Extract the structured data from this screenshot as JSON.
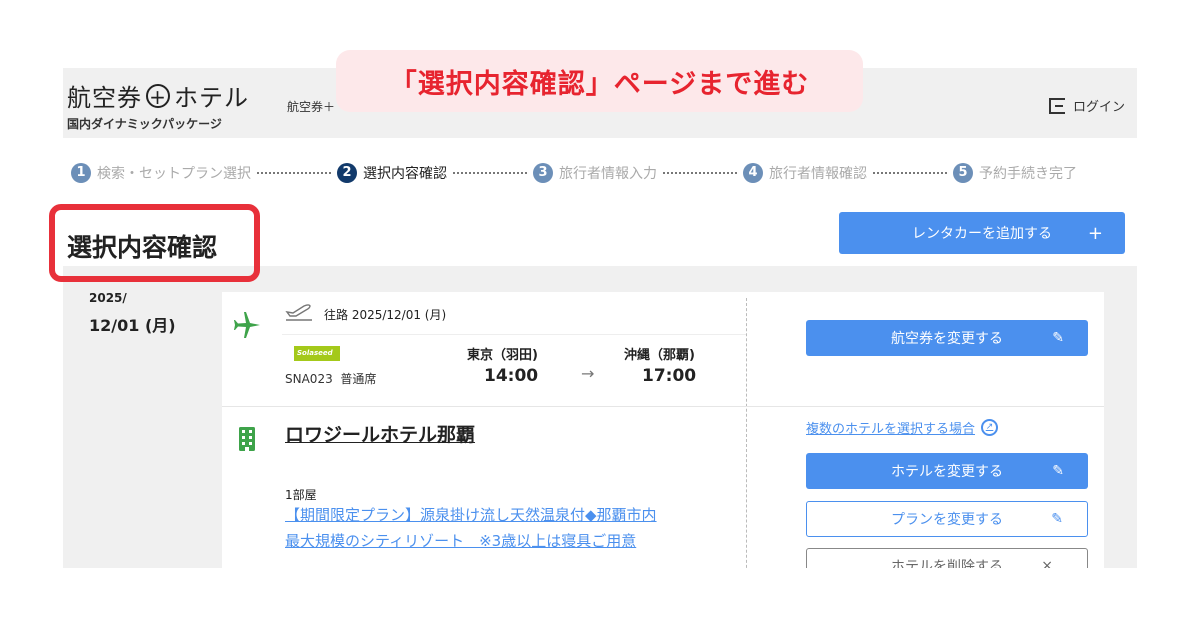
{
  "brand": {
    "title_left": "航空券",
    "plus": "+",
    "title_right": "ホテル",
    "subtitle": "国内ダイナミックパッケージ"
  },
  "nav": {
    "link": "航空券＋"
  },
  "login": {
    "label": "ログイン",
    "icon": "login-icon"
  },
  "banner": {
    "text": "「選択内容確認」ページまで進む"
  },
  "steps": [
    {
      "num": "1",
      "label": "検索・セットプラン選択",
      "active": false
    },
    {
      "num": "2",
      "label": "選択内容確認",
      "active": true
    },
    {
      "num": "3",
      "label": "旅行者情報入力",
      "active": false
    },
    {
      "num": "4",
      "label": "旅行者情報確認",
      "active": false
    },
    {
      "num": "5",
      "label": "予約手続き完了",
      "active": false
    }
  ],
  "page_title": "選択内容確認",
  "rental_button": {
    "label": "レンタカーを追加する",
    "icon": "+"
  },
  "date": {
    "year": "2025/",
    "day": "12/01 (月)"
  },
  "flight": {
    "route_label": "往路 2025/12/01 (月)",
    "airline_logo_text": "Solaseed",
    "flight_no": "SNA023",
    "seat": "普通席",
    "from": {
      "name": "東京（羽田)",
      "time": "14:00"
    },
    "arrow": "→",
    "to": {
      "name": "沖縄（那覇)",
      "time": "17:00"
    },
    "change_button": "航空券を変更する"
  },
  "hotel": {
    "name": "ロワジールホテル那覇",
    "rooms": "1部屋",
    "plan_link": "【期間限定プラン】源泉掛け流し天然温泉付◆那覇市内最大規模のシティリゾート　※3歳以上は寝具ご用意",
    "multi_link": "複数のホテルを選択する場合",
    "change_button": "ホテルを変更する",
    "change_plan_button": "プランを変更する",
    "delete_button": "ホテルを削除する",
    "delete_icon": "×",
    "edit_icon": "✎"
  },
  "colors": {
    "accent": "#4b90ee",
    "highlight": "#e8303a",
    "banner_bg": "#fde8ea",
    "step_active": "#123a6b"
  }
}
